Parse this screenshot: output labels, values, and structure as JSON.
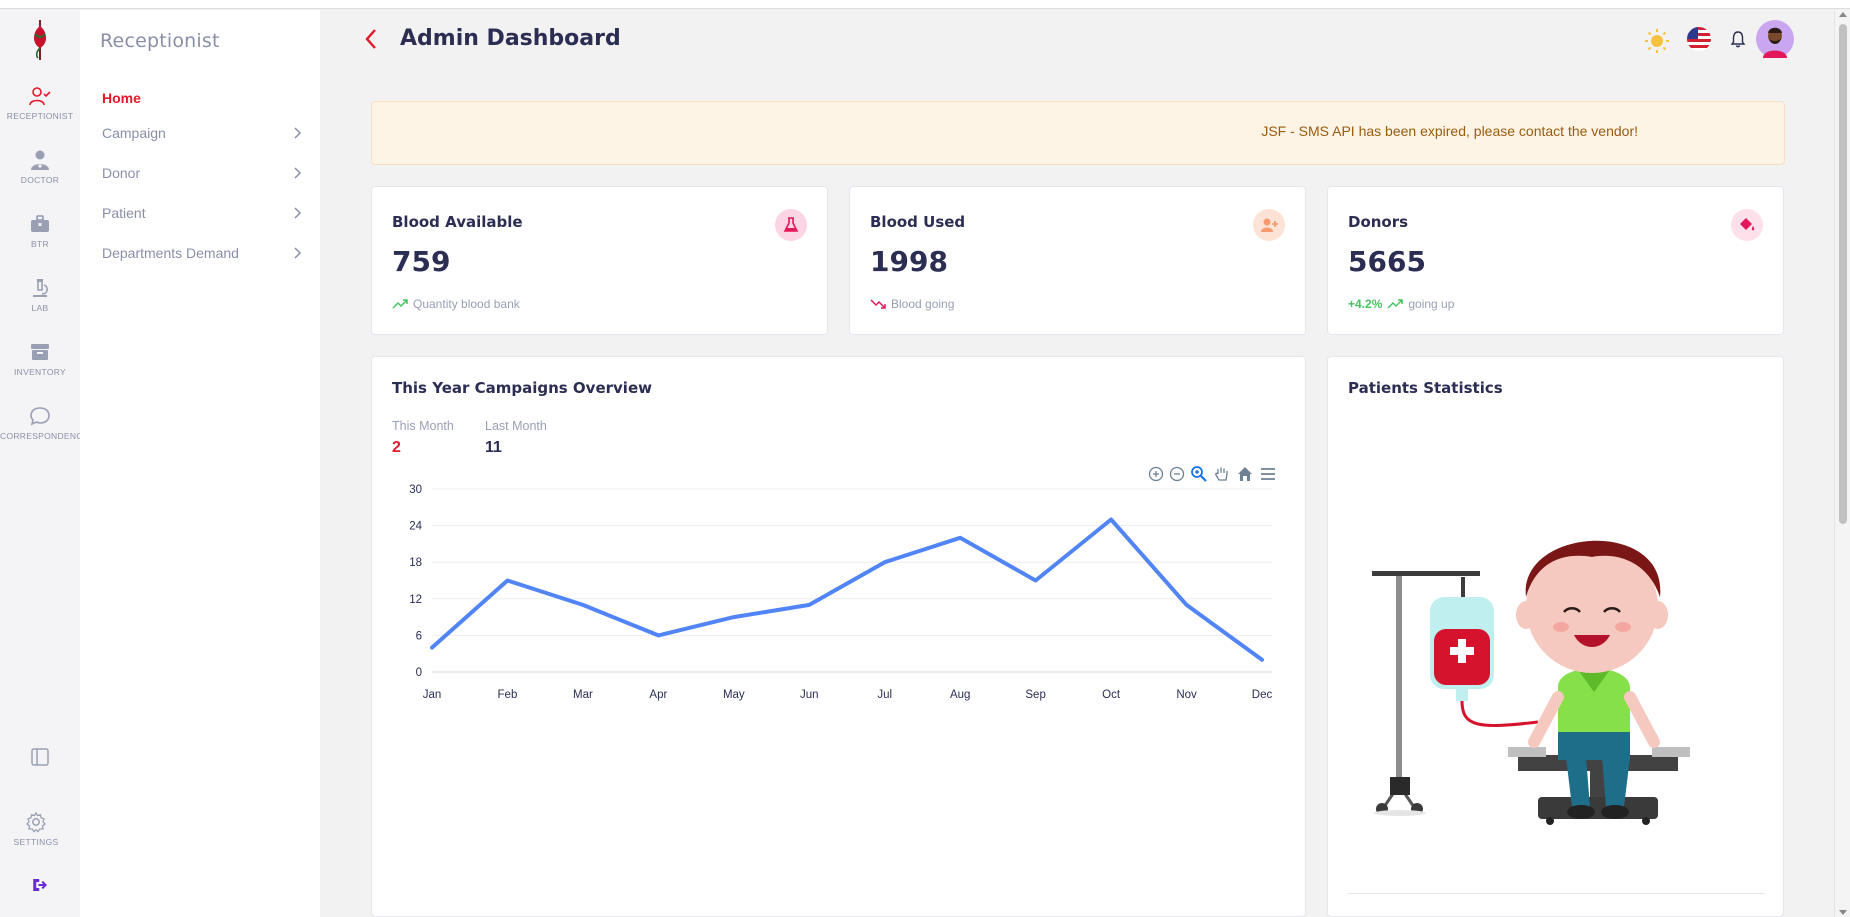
{
  "app": {
    "section_title": "Receptionist",
    "page_title": "Admin Dashboard",
    "accent_color": "#e3182b",
    "primary_text_color": "#2b2d52"
  },
  "rail": {
    "items": [
      {
        "label": "RECEPTIONIST",
        "icon": "user-check-icon"
      },
      {
        "label": "DOCTOR",
        "icon": "doctor-icon"
      },
      {
        "label": "BTR",
        "icon": "briefcase-icon"
      },
      {
        "label": "LAB",
        "icon": "microscope-icon"
      },
      {
        "label": "INVENTORY",
        "icon": "archive-box-icon"
      },
      {
        "label": "CORRESPONDENCE",
        "icon": "chat-bubble-icon"
      }
    ],
    "bottom": {
      "layout_icon": "sidebar-layout-icon",
      "settings_label": "SETTINGS",
      "logout_icon": "logout-icon"
    }
  },
  "subnav": {
    "items": [
      {
        "label": "Home",
        "active": true
      },
      {
        "label": "Campaign"
      },
      {
        "label": "Donor"
      },
      {
        "label": "Patient"
      },
      {
        "label": "Departments Demand"
      }
    ]
  },
  "header_icons": [
    "sun-icon",
    "us-flag-icon",
    "bell-icon",
    "user-avatar-icon"
  ],
  "alert": {
    "text": "JSF - SMS API has been expired, please contact the vendor!"
  },
  "stats": [
    {
      "title": "Blood Available",
      "value": "759",
      "sub": "Quantity blood bank",
      "trend": "up",
      "icon": "flask-icon",
      "badge_color": "#fbd5e3"
    },
    {
      "title": "Blood Used",
      "value": "1998",
      "sub": "Blood going",
      "trend": "down",
      "icon": "user-plus-icon",
      "badge_color": "#fde3d6"
    },
    {
      "title": "Donors",
      "value": "5665",
      "pct": "+4.2%",
      "sub": "going up",
      "trend": "up",
      "icon": "paint-bucket-icon",
      "badge_color": "#fde0ea"
    }
  ],
  "campaigns": {
    "title": "This Year Campaigns Overview",
    "this_month_label": "This Month",
    "this_month_value": "2",
    "last_month_label": "Last Month",
    "last_month_value": "11"
  },
  "patients": {
    "title": "Patients Statistics"
  },
  "chart_data": {
    "type": "line",
    "title": "",
    "xlabel": "",
    "ylabel": "",
    "categories": [
      "Jan",
      "Feb",
      "Mar",
      "Apr",
      "May",
      "Jun",
      "Jul",
      "Aug",
      "Sep",
      "Oct",
      "Nov",
      "Dec"
    ],
    "series": [
      {
        "values": [
          4,
          15,
          11,
          6,
          9,
          11,
          18,
          22,
          15,
          25,
          11,
          2
        ],
        "color": "#5185f7"
      }
    ],
    "ylim": [
      0,
      30
    ],
    "yticks": [
      0,
      6,
      12,
      18,
      24,
      30
    ],
    "grid": true,
    "toolbar_icons": [
      "zoom-in-icon",
      "zoom-out-icon",
      "selection-zoom-icon",
      "pan-hand-icon",
      "reset-home-icon",
      "chart-menu-icon"
    ]
  }
}
